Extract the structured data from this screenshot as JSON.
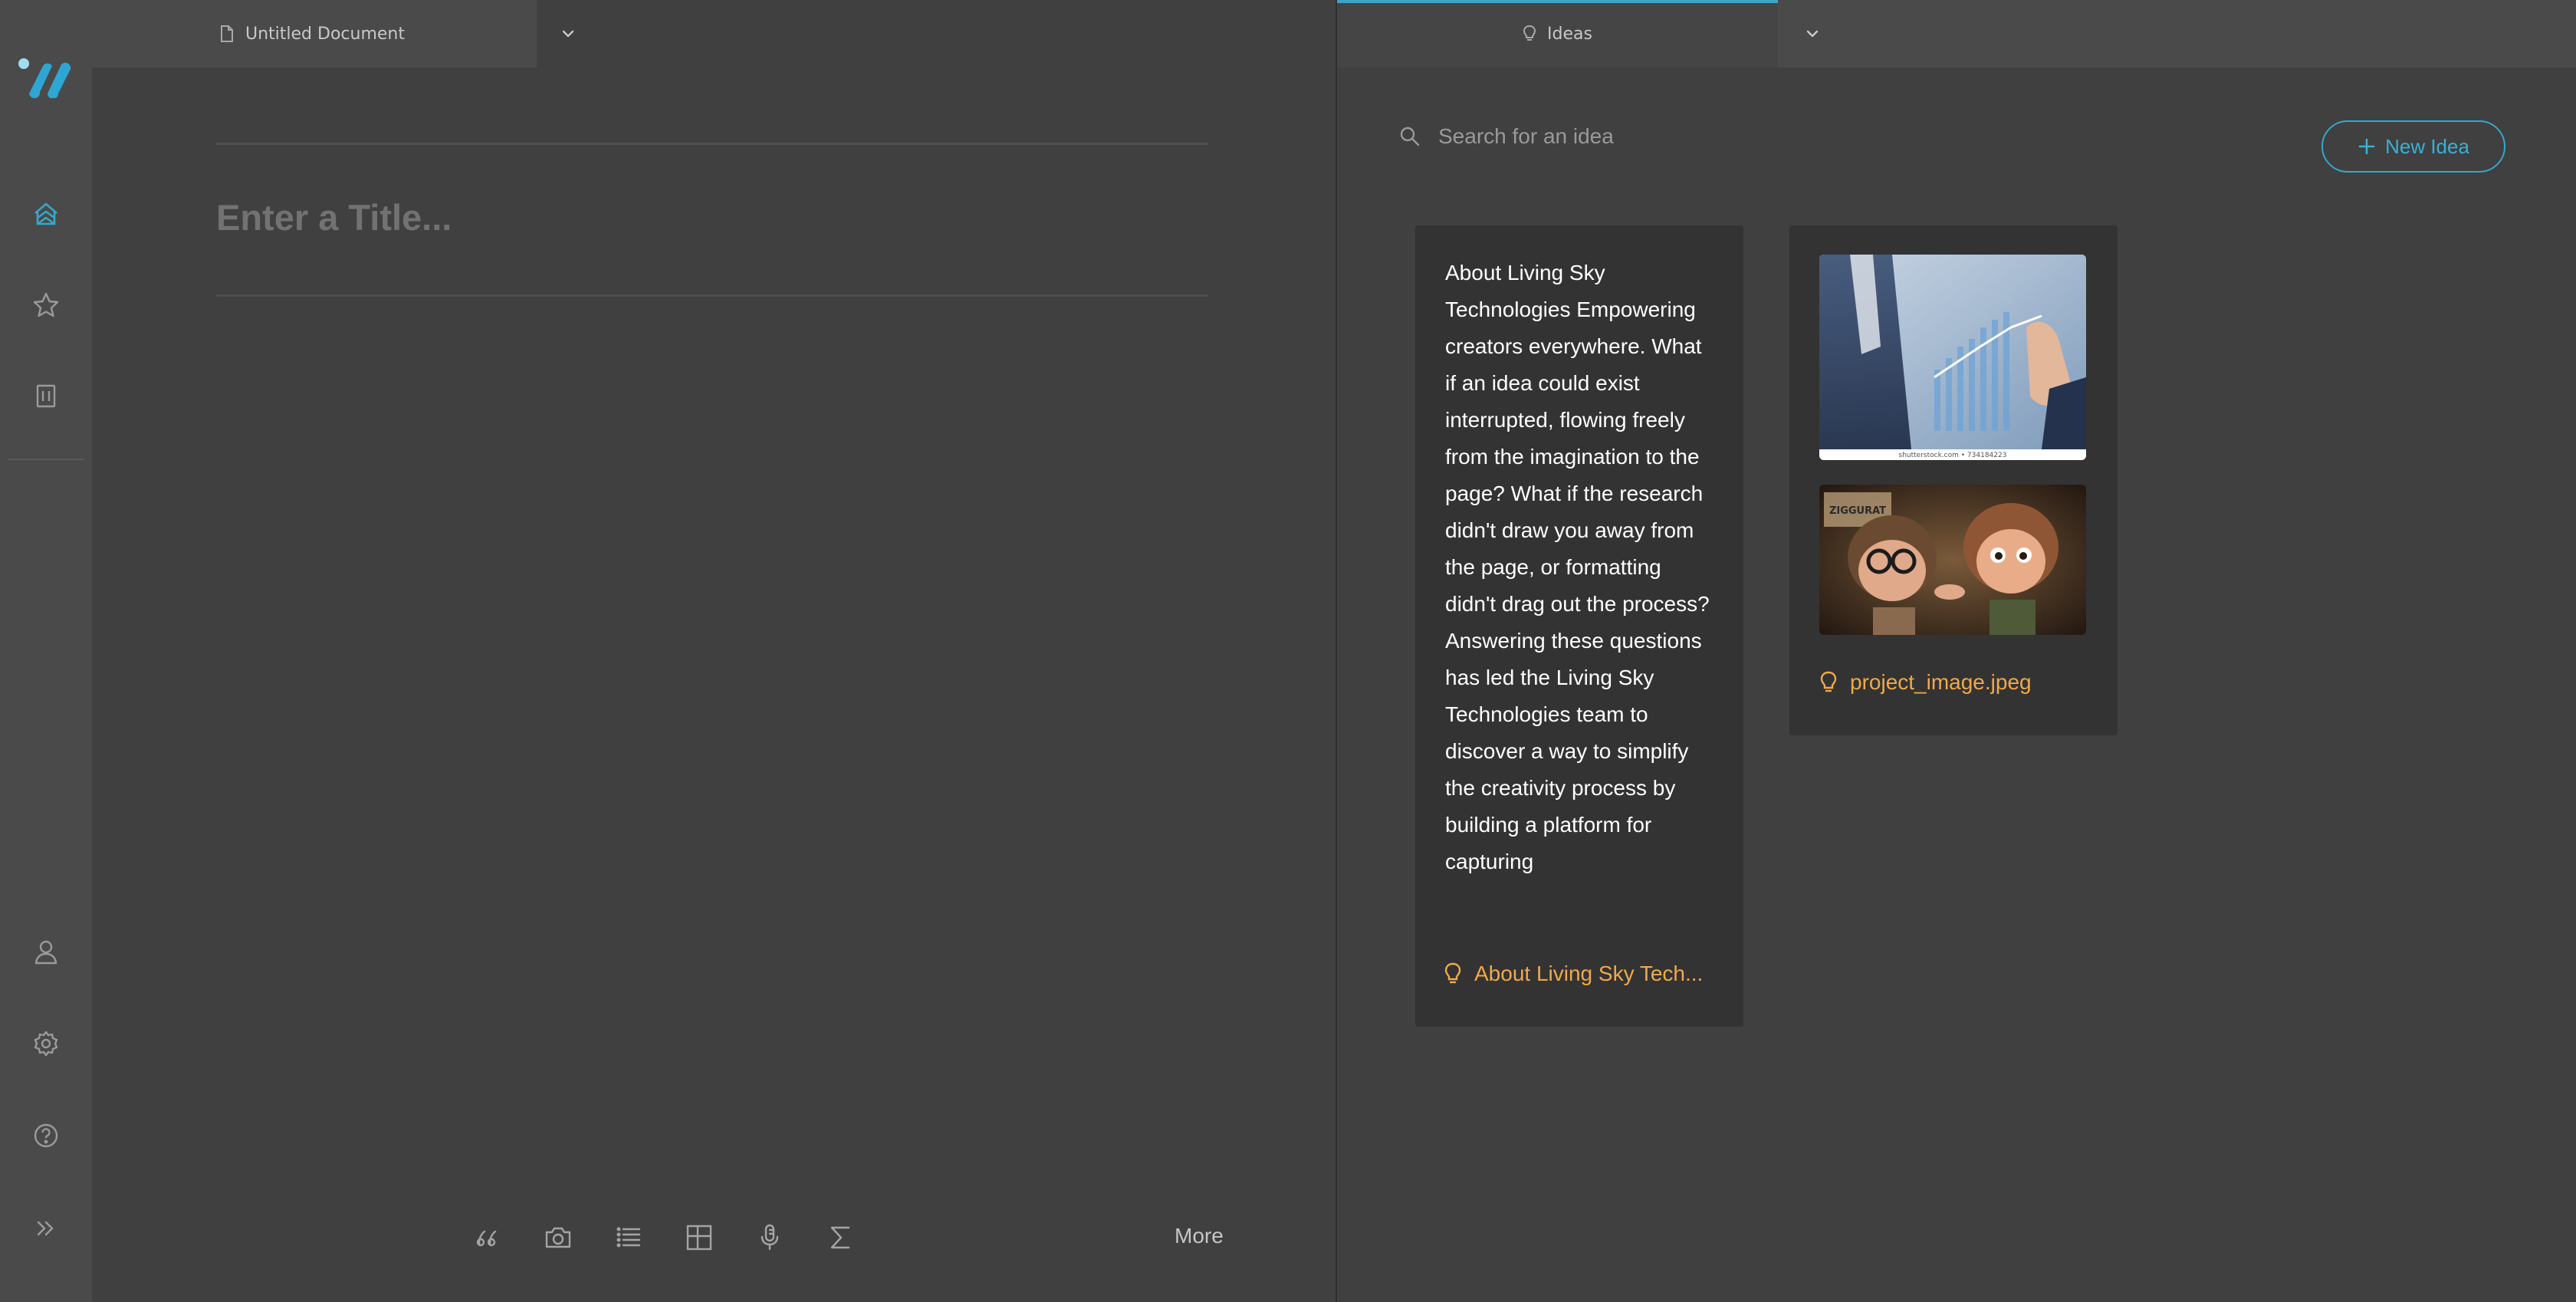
{
  "sidebar": {
    "icons": [
      "logo-icon",
      "home-icon",
      "star-icon",
      "trash-icon",
      "user-icon",
      "gear-icon",
      "help-icon",
      "chevrons-right-icon"
    ]
  },
  "editor": {
    "tab": {
      "label": "Untitled Document"
    },
    "title_placeholder": "Enter a Title...",
    "toolbar": {
      "icons": [
        "quote-icon",
        "camera-icon",
        "list-icon",
        "table-icon",
        "microphone-icon",
        "sigma-icon"
      ],
      "more_label": "More"
    }
  },
  "ideas": {
    "tab": {
      "label": "Ideas"
    },
    "search": {
      "placeholder": "Search for an idea"
    },
    "new_idea_label": "New Idea",
    "cards": [
      {
        "text": "About Living Sky Technologies Empowering creators everywhere. What if an idea could exist interrupted, flowing freely from the imagination to the page? What if the research didn't draw you away from the page, or formatting didn't drag out the process? Answering these questions has led the Living Sky Technologies team to discover a way to simplify the creativity process by building a platform for capturing",
        "footer": "About Living Sky Tech..."
      },
      {
        "images": [
          {
            "watermark": "shutterstock.com • 734184223"
          },
          {
            "sign": "ZIGGURAT"
          }
        ],
        "footer": "project_image.jpeg"
      }
    ]
  },
  "colors": {
    "accent_blue": "#39b0d6",
    "idea_orange": "#f0a94a",
    "sidebar_bg": "#4a4a4a",
    "pane_bg": "#404040",
    "card_bg": "#333333"
  }
}
